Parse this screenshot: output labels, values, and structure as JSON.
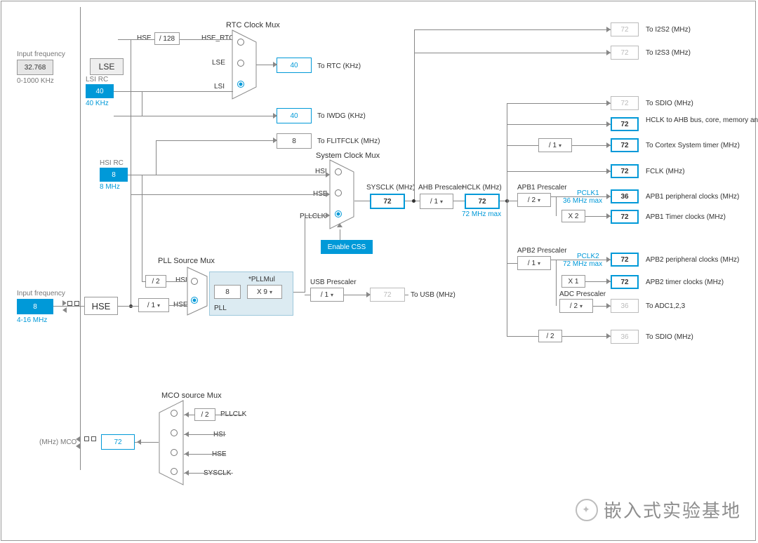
{
  "inputs": {
    "lse_freq_label": "Input frequency",
    "lse_freq_value": "32.768",
    "lse_freq_range": "0-1000 KHz",
    "hse_freq_label": "Input frequency",
    "hse_freq_value": "8",
    "hse_freq_range": "4-16 MHz"
  },
  "sources": {
    "lse_name": "LSE",
    "lsi_rc_label": "LSI RC",
    "lsi_value": "40",
    "lsi_unit": "40 KHz",
    "hsi_rc_label": "HSI RC",
    "hsi_value": "8",
    "hsi_unit": "8 MHz",
    "hse_name": "HSE"
  },
  "rtc": {
    "mux_title": "RTC Clock Mux",
    "hse_div": "/ 128",
    "hse_line": "HSE",
    "hse_rtc": "HSE_RTC",
    "lse_line": "LSE",
    "lsi_line": "LSI",
    "rtc_value": "40",
    "rtc_label": "To RTC (KHz)",
    "iwdg_value": "40",
    "iwdg_label": "To IWDG (KHz)"
  },
  "flitf": {
    "value": "8",
    "label": "To FLITFCLK (MHz)"
  },
  "pll": {
    "src_title": "PLL Source Mux",
    "hsi_div2": "/ 2",
    "hsi_line": "HSI",
    "hse_line": "HSE",
    "hse_presc": "/ 1",
    "mul_label": "*PLLMul",
    "mul_sel": "X 9",
    "pll_v": "8",
    "pll_name": "PLL"
  },
  "sysclk": {
    "mux_title": "System Clock Mux",
    "hsi": "HSI",
    "hse": "HSE",
    "pllclk": "PLLCLK",
    "css": "Enable CSS",
    "label": "SYSCLK (MHz)",
    "value": "72"
  },
  "usb": {
    "presc_label": "USB Prescaler",
    "presc": "/ 1",
    "value": "72",
    "label": "To USB (MHz)"
  },
  "ahb": {
    "label": "AHB Prescaler",
    "presc": "/ 1",
    "hclk_label": "HCLK (MHz)",
    "hclk_value": "72",
    "hclk_max": "72 MHz max"
  },
  "outputs": {
    "i2s2": {
      "v": "72",
      "l": "To I2S2 (MHz)"
    },
    "i2s3": {
      "v": "72",
      "l": "To I2S3 (MHz)"
    },
    "sdio": {
      "v": "72",
      "l": "To SDIO (MHz)"
    },
    "ahbbus": {
      "v": "72",
      "l": "HCLK to AHB bus, core, memory and DMA (MHz)"
    },
    "cortex": {
      "presc": "/ 1",
      "v": "72",
      "l": "To Cortex System timer (MHz)"
    },
    "fclk": {
      "v": "72",
      "l": "FCLK (MHz)"
    }
  },
  "apb1": {
    "label": "APB1 Prescaler",
    "presc": "/ 2",
    "pclk1": "PCLK1",
    "max": "36 MHz max",
    "periph": {
      "v": "36",
      "l": "APB1 peripheral clocks (MHz)"
    },
    "timer_mul": "X 2",
    "timer": {
      "v": "72",
      "l": "APB1 Timer clocks (MHz)"
    }
  },
  "apb2": {
    "label": "APB2 Prescaler",
    "presc": "/ 1",
    "pclk2": "PCLK2",
    "max": "72 MHz max",
    "periph": {
      "v": "72",
      "l": "APB2 peripheral clocks (MHz)"
    },
    "timer_mul": "X 1",
    "timer": {
      "v": "72",
      "l": "APB2 timer clocks (MHz)"
    },
    "adc_label": "ADC Prescaler",
    "adc_presc": "/ 2",
    "adc": {
      "v": "36",
      "l": "To ADC1,2,3"
    },
    "sdio_div": "/ 2",
    "sdio": {
      "v": "36",
      "l": "To SDIO (MHz)"
    }
  },
  "mco": {
    "title": "MCO source Mux",
    "div2": "/ 2",
    "pllclk": "PLLCLK",
    "hsi": "HSI",
    "hse": "HSE",
    "sysclk": "SYSCLK",
    "value": "72",
    "port_label": "(MHz) MCO"
  },
  "watermark": "嵌入式实验基地"
}
